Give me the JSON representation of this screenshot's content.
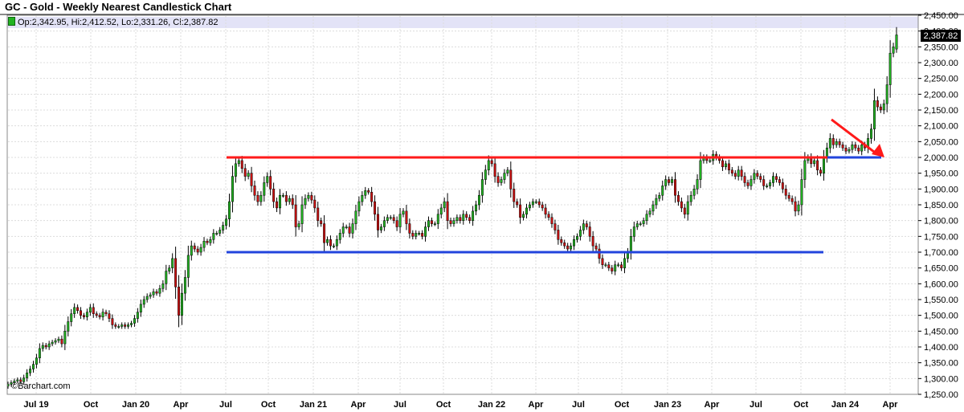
{
  "header": {
    "title": "GC - Gold - Weekly Nearest Candlestick Chart",
    "ohlc": "Op:2,342.95, Hi:2,412.52, Lo:2,331.26, Cl:2,387.82"
  },
  "watermark": "©Barchart.com",
  "colors": {
    "up": "#22b322",
    "down": "#cc1111",
    "resistance": "#ff1a1a",
    "support": "#2244dd",
    "last_price_bg": "#000000",
    "highlight_band": "#e3e3f7"
  },
  "chart_data": {
    "type": "candlestick",
    "title": "GC - Gold - Weekly Nearest Candlestick Chart",
    "ylim": [
      1250,
      2450
    ],
    "y_ticks": [
      "2,450.00",
      "2,400.00",
      "2,350.00",
      "2,300.00",
      "2,250.00",
      "2,200.00",
      "2,150.00",
      "2,100.00",
      "2,050.00",
      "2,000.00",
      "1,950.00",
      "1,900.00",
      "1,850.00",
      "1,800.00",
      "1,750.00",
      "1,700.00",
      "1,650.00",
      "1,600.00",
      "1,550.00",
      "1,500.00",
      "1,450.00",
      "1,400.00",
      "1,350.00",
      "1,300.00",
      "1,250.00"
    ],
    "x_ticks": [
      "Jul 19",
      "Oct",
      "Jan 20",
      "Apr",
      "Jul",
      "Oct",
      "Jan 21",
      "Apr",
      "Jul",
      "Oct",
      "Jan 22",
      "Apr",
      "Jul",
      "Oct",
      "Jan 23",
      "Apr",
      "Jul",
      "Oct",
      "Jan 24",
      "Apr"
    ],
    "last_price": "2,387.82",
    "last_bar": {
      "open": 2342.95,
      "high": 2412.52,
      "low": 2331.26,
      "close": 2387.82
    },
    "closes": [
      1282,
      1287,
      1292,
      1296,
      1290,
      1302,
      1318,
      1330,
      1345,
      1365,
      1395,
      1405,
      1400,
      1410,
      1415,
      1420,
      1425,
      1410,
      1450,
      1480,
      1505,
      1525,
      1515,
      1500,
      1495,
      1510,
      1525,
      1505,
      1500,
      1495,
      1510,
      1505,
      1490,
      1470,
      1465,
      1465,
      1470,
      1465,
      1470,
      1475,
      1490,
      1510,
      1535,
      1550,
      1560,
      1565,
      1575,
      1570,
      1585,
      1600,
      1640,
      1650,
      1680,
      1590,
      1500,
      1570,
      1620,
      1690,
      1720,
      1710,
      1700,
      1715,
      1735,
      1730,
      1740,
      1760,
      1760,
      1770,
      1785,
      1805,
      1860,
      1940,
      1980,
      1990,
      1965,
      1940,
      1950,
      1910,
      1880,
      1860,
      1880,
      1920,
      1940,
      1900,
      1860,
      1840,
      1880,
      1880,
      1860,
      1870,
      1850,
      1780,
      1790,
      1850,
      1870,
      1880,
      1865,
      1840,
      1800,
      1790,
      1730,
      1740,
      1720,
      1720,
      1740,
      1760,
      1780,
      1780,
      1760,
      1790,
      1830,
      1860,
      1880,
      1895,
      1890,
      1860,
      1820,
      1770,
      1780,
      1800,
      1810,
      1810,
      1800,
      1780,
      1820,
      1830,
      1790,
      1760,
      1750,
      1760,
      1760,
      1750,
      1780,
      1800,
      1790,
      1790,
      1820,
      1840,
      1860,
      1800,
      1790,
      1800,
      1810,
      1800,
      1820,
      1810,
      1800,
      1830,
      1850,
      1880,
      1930,
      1960,
      1990,
      1980,
      1940,
      1920,
      1930,
      1950,
      1960,
      1900,
      1860,
      1850,
      1810,
      1820,
      1840,
      1850,
      1860,
      1860,
      1850,
      1840,
      1820,
      1810,
      1790,
      1770,
      1740,
      1730,
      1720,
      1710,
      1720,
      1740,
      1750,
      1770,
      1790,
      1780,
      1750,
      1720,
      1710,
      1680,
      1660,
      1660,
      1650,
      1640,
      1660,
      1660,
      1650,
      1680,
      1700,
      1750,
      1780,
      1790,
      1790,
      1800,
      1820,
      1830,
      1850,
      1870,
      1880,
      1910,
      1930,
      1920,
      1930,
      1880,
      1860,
      1840,
      1820,
      1860,
      1880,
      1900,
      1930,
      1990,
      2000,
      1990,
      1990,
      2010,
      2000,
      1990,
      1970,
      1980,
      1960,
      1950,
      1940,
      1960,
      1940,
      1920,
      1910,
      1930,
      1950,
      1940,
      1930,
      1910,
      1910,
      1920,
      1940,
      1930,
      1920,
      1900,
      1880,
      1870,
      1860,
      1830,
      1850,
      1930,
      1990,
      2000,
      1980,
      1990,
      1960,
      1950,
      2000,
      2030,
      2060,
      2040,
      2050,
      2040,
      2030,
      2020,
      2025,
      2040,
      2030,
      2020,
      2040,
      2030,
      2060,
      2090,
      2180,
      2160,
      2150,
      2170,
      2230,
      2330,
      2350,
      2387.82
    ]
  }
}
